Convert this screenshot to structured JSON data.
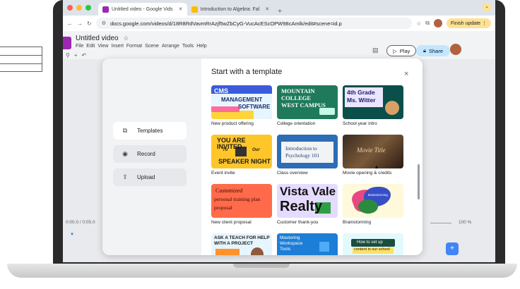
{
  "browser": {
    "tabs": [
      {
        "title": "Untitled video - Google Vids",
        "active": true
      },
      {
        "title": "Introduction to Algebra: Fal",
        "active": false
      }
    ],
    "new_tab": "+",
    "url": "docs.google.com/videos/d/18R8RdVavmRrAzjf5wZbCyG-VucAcEScOPW98cAmlk/edit#scene=id.p",
    "finish_update": "Finish update"
  },
  "doc": {
    "title": "Untitled video",
    "star": "☆",
    "menu": [
      "File",
      "Edit",
      "View",
      "Insert",
      "Format",
      "Scene",
      "Arrange",
      "Tools",
      "Help"
    ],
    "play_label": "Play",
    "share_label": "Share",
    "timeline_time": "0:00.0 / 0:05.0",
    "zoom": "100 %"
  },
  "modal": {
    "title": "Start with a template",
    "close": "×",
    "side_items": [
      {
        "label": "Templates",
        "icon": "template-icon"
      },
      {
        "label": "Record",
        "icon": "record-icon"
      },
      {
        "label": "Upload",
        "icon": "upload-icon"
      }
    ],
    "templates": [
      {
        "label": "New product offering",
        "lines": [
          "CMS",
          "MANAGEMENT",
          "SOFTWARE"
        ]
      },
      {
        "label": "College orientation",
        "lines": [
          "MOUNTAIN",
          "COLLEGE",
          "WEST CAMPUS"
        ]
      },
      {
        "label": "School year intro",
        "lines": [
          "4th Grade",
          "Ms. Witter"
        ]
      },
      {
        "label": "Event invite",
        "lines": [
          "YOU ARE INVITED",
          "To",
          "Our",
          "SPEAKER NIGHT"
        ]
      },
      {
        "label": "Class overview",
        "lines": [
          "Introduction to",
          "Psychology 101"
        ]
      },
      {
        "label": "Movie opening & credits",
        "lines": [
          "Movie Title"
        ]
      },
      {
        "label": "New client proposal",
        "lines": [
          "Customized",
          "personal training plan",
          "proposal"
        ]
      },
      {
        "label": "Customer thank-you",
        "lines": [
          "Vista Vale",
          "Realty"
        ]
      },
      {
        "label": "Brainstorming",
        "lines": [
          "Brainstorming"
        ]
      },
      {
        "label": "",
        "lines": [
          "ASK A TEACH FOR HELP",
          "WITH A PROJECT"
        ]
      },
      {
        "label": "",
        "lines": [
          "Mastering",
          "Workspace",
          "Tools"
        ]
      },
      {
        "label": "",
        "lines": [
          "How to set up",
          "content in our school"
        ]
      }
    ]
  }
}
